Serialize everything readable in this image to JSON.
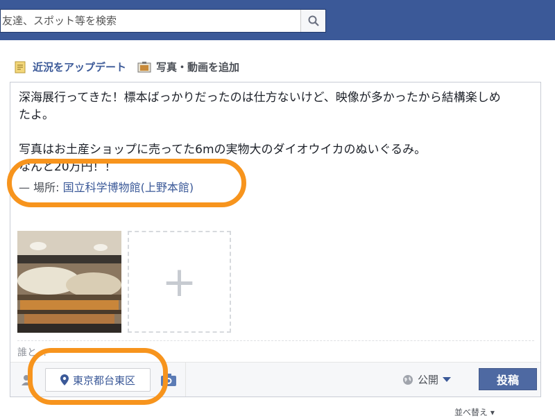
{
  "search": {
    "placeholder": "友達、スポット等を検索",
    "icon": "search-icon"
  },
  "composer": {
    "tabs": [
      {
        "label": "近況をアップデート",
        "icon": "status-update-icon"
      },
      {
        "label": "写真・動画を追加",
        "icon": "photo-icon"
      }
    ],
    "status_lines": [
      "深海展行ってきた！標本ばっかりだったのは仕方ないけど、映像が多かったから結構楽しめ",
      "たよ。",
      "",
      "写真はお土産ショップに売ってた6mの実物大のダイオウイカのぬいぐるみ。",
      "なんと20万円！！"
    ],
    "place_prefix": "— 場所:",
    "place_name": "国立科学博物館(上野本館)",
    "add_photo_symbol": "+",
    "with_placeholder": "誰と…",
    "location_chip": "東京都台東区",
    "privacy_label": "公開",
    "post_label": "投稿"
  },
  "sort_label": "並べ替え",
  "colors": {
    "brand": "#3b5998",
    "highlight": "#f7941d",
    "post_button": "#4e69a2"
  }
}
